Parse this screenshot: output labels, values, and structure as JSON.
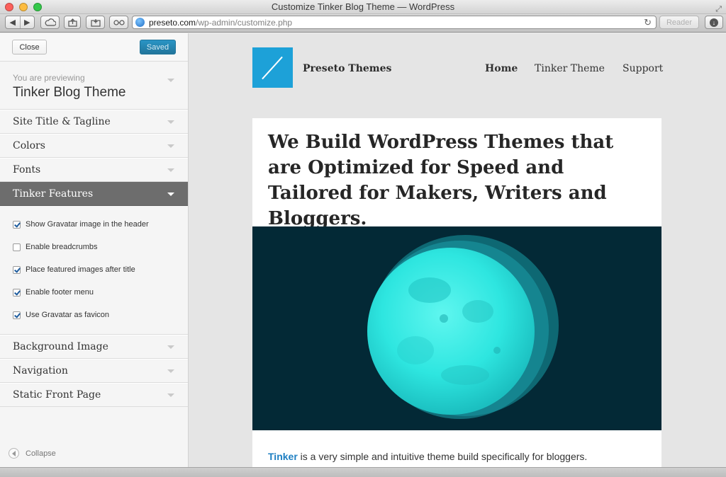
{
  "window": {
    "title": "Customize Tinker Blog Theme — WordPress"
  },
  "toolbar": {
    "back_icon": "back-arrow-icon",
    "forward_icon": "forward-arrow-icon",
    "url_host": "preseto.com",
    "url_path": "/wp-admin/customize.php",
    "reader_label": "Reader"
  },
  "sidebar": {
    "close_label": "Close",
    "saved_label": "Saved",
    "previewing_label": "You are previewing",
    "theme_name": "Tinker Blog Theme",
    "sections": [
      {
        "label": "Site Title & Tagline"
      },
      {
        "label": "Colors"
      },
      {
        "label": "Fonts"
      },
      {
        "label": "Tinker Features"
      },
      {
        "label": "Background Image"
      },
      {
        "label": "Navigation"
      },
      {
        "label": "Static Front Page"
      }
    ],
    "features": [
      {
        "label": "Show Gravatar image in the header",
        "checked": true
      },
      {
        "label": "Enable breadcrumbs",
        "checked": false
      },
      {
        "label": "Place featured images after title",
        "checked": true
      },
      {
        "label": "Enable footer menu",
        "checked": true
      },
      {
        "label": "Use Gravatar as favicon",
        "checked": true
      }
    ],
    "collapse_label": "Collapse"
  },
  "site": {
    "name": "Preseto Themes",
    "nav": [
      {
        "label": "Home"
      },
      {
        "label": "Tinker Theme"
      },
      {
        "label": "Support"
      }
    ],
    "headline": "We Build WordPress Themes that are Optimized for Speed and Tailored for Makers, Writers and Bloggers.",
    "intro_link": "Tinker",
    "intro_text": " is a very simple and intuitive theme build specifically for bloggers."
  },
  "colors": {
    "accent": "#1da1d8",
    "saved_button": "#21759b",
    "hero_background": "#032936",
    "moon": "#2ee6e0"
  }
}
